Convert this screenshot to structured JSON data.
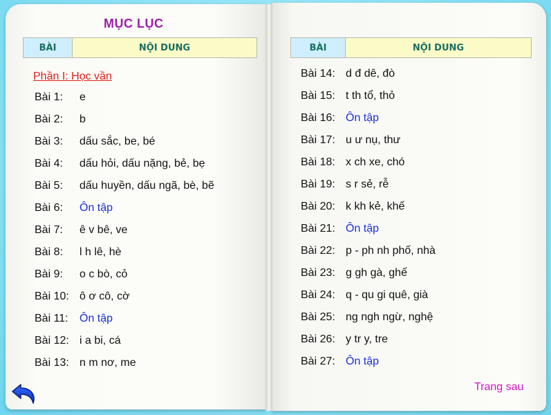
{
  "title": "MỤC LỤC",
  "table_headers": {
    "lesson": "BÀI",
    "content": "NỘI DUNG"
  },
  "section_1": "Phần I: Học vần",
  "left_lessons": [
    {
      "num": "Bài 1:",
      "title": "e"
    },
    {
      "num": "Bài 2:",
      "title": "b"
    },
    {
      "num": "Bài 3:",
      "title": "dấu sắc, be, bé"
    },
    {
      "num": "Bài 4:",
      "title": "dấu hỏi, dấu nặng, bẻ, bẹ"
    },
    {
      "num": "Bài 5:",
      "title": "dấu huyền, dấu ngã, bè, bẽ"
    },
    {
      "num": "Bài 6:",
      "title": "Ôn tập"
    },
    {
      "num": "Bài 7:",
      "title": "ê v bê, ve"
    },
    {
      "num": "Bài 8:",
      "title": "l h lê, hè"
    },
    {
      "num": "Bài 9:",
      "title": "o c bò, cỏ"
    },
    {
      "num": "Bài 10:",
      "title": "ô ơ cô, cờ"
    },
    {
      "num": "Bài 11:",
      "title": "Ôn tập"
    },
    {
      "num": "Bài 12:",
      "title": "i a bi, cá"
    },
    {
      "num": "Bài 13:",
      "title": "n m nơ, me"
    }
  ],
  "right_lessons": [
    {
      "num": "Bài 14:",
      "title": "d đ dê, đò"
    },
    {
      "num": "Bài 15:",
      "title": "t th tổ, thỏ"
    },
    {
      "num": "Bài 16:",
      "title": "Ôn tập"
    },
    {
      "num": "Bài 17:",
      "title": "u ư nụ, thư"
    },
    {
      "num": "Bài 18:",
      "title": "x ch xe, chó"
    },
    {
      "num": "Bài 19:",
      "title": "s r sẻ, rễ"
    },
    {
      "num": "Bài 20:",
      "title": "k kh kẻ, khế"
    },
    {
      "num": "Bài 21:",
      "title": "Ôn tập"
    },
    {
      "num": "Bài 22:",
      "title": "p - ph nh phố, nhà"
    },
    {
      "num": "Bài 23:",
      "title": "g gh gà, ghế"
    },
    {
      "num": "Bài 24:",
      "title": "q - qu gi quê, già"
    },
    {
      "num": "Bài 25:",
      "title": "ng ngh ngừ, nghệ"
    },
    {
      "num": "Bài 26:",
      "title": "y tr y, tre"
    },
    {
      "num": "Bài 27:",
      "title": "Ôn tập"
    }
  ],
  "next_page": "Trang sau",
  "colors": {
    "title": "#9b1fa6",
    "section": "#e0201a",
    "review": "#1a2fd8",
    "next": "#d417c4",
    "background": "#8fe3f6"
  },
  "icons": {
    "back": "back-arrow-icon"
  }
}
